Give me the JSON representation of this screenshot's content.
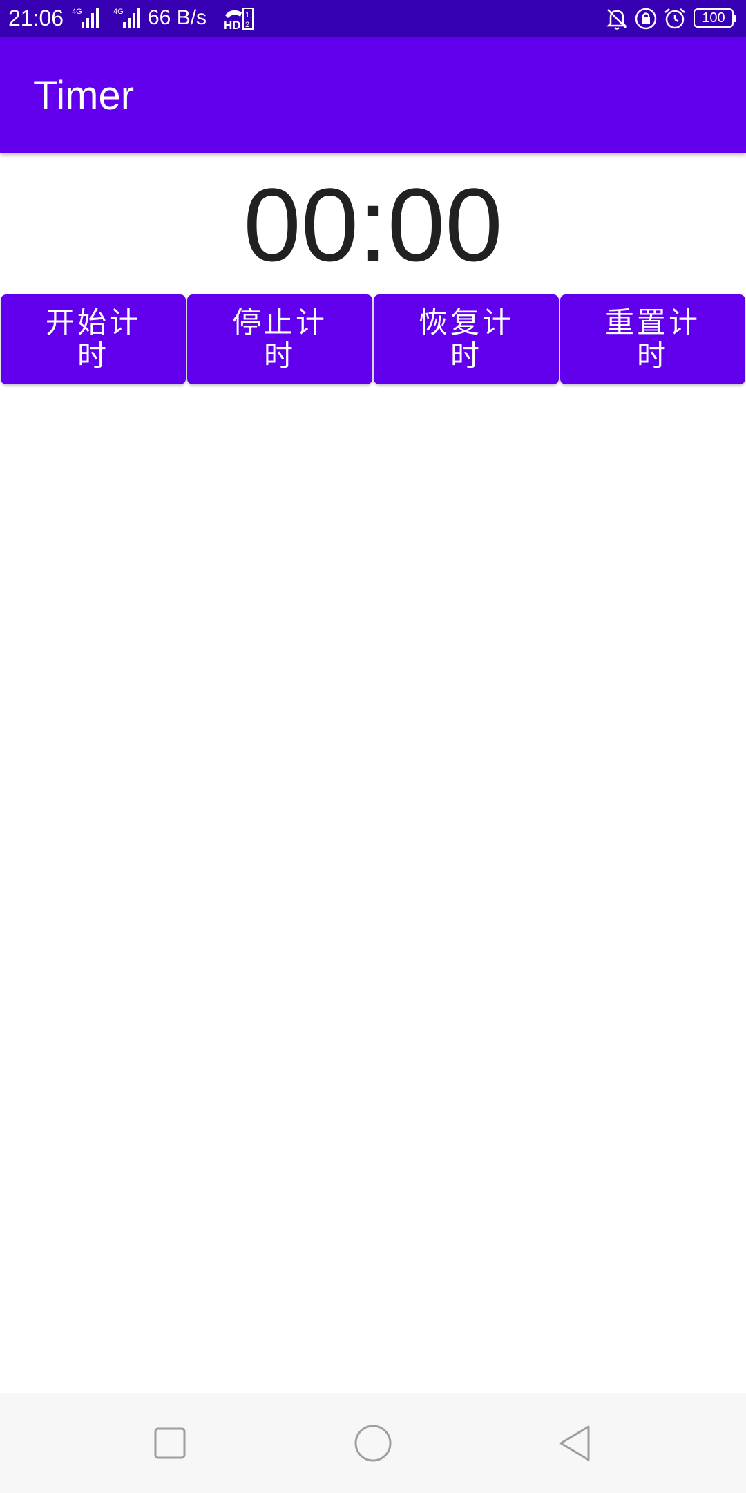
{
  "status_bar": {
    "time": "21:06",
    "net_speed": "66 B/s",
    "battery": "100",
    "icons": [
      "signal-4g-icon",
      "signal-4g-icon",
      "hd-call-icon",
      "bell-off-icon",
      "rotation-lock-icon",
      "alarm-icon",
      "battery-icon"
    ]
  },
  "app_bar": {
    "title": "Timer"
  },
  "timer": {
    "display": "00:00"
  },
  "buttons": {
    "start": "开始计时",
    "stop": "停止计时",
    "resume": "恢复计时",
    "reset": "重置计时"
  },
  "nav_bar": {
    "icons": [
      "recents-icon",
      "home-icon",
      "back-icon"
    ]
  },
  "colors": {
    "status_bar": "#3700b3",
    "primary": "#6200ee",
    "timer_text": "#212121",
    "nav_bar": "#f7f7f7"
  }
}
